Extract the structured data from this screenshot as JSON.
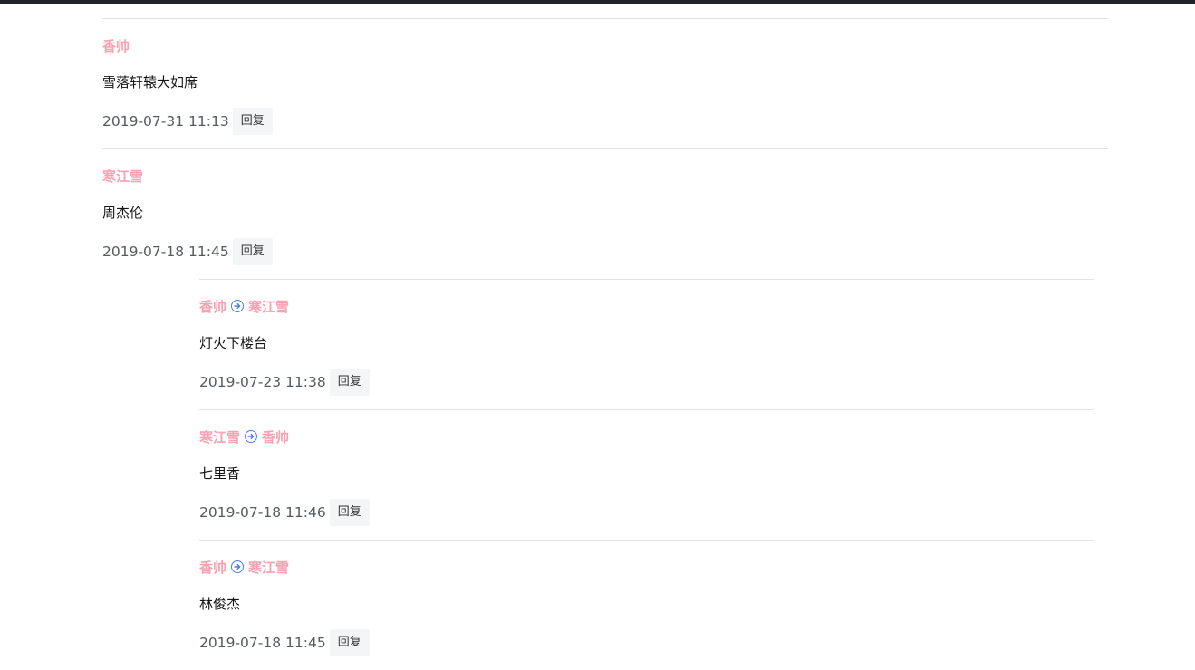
{
  "comments": [
    {
      "author": "香帅",
      "content": "雪落轩辕大如席",
      "time": "2019-07-31 11:13",
      "reply_label": "回复"
    },
    {
      "author": "寒江雪",
      "content": "周杰伦",
      "time": "2019-07-18 11:45",
      "reply_label": "回复",
      "replies": [
        {
          "from": "香帅",
          "to": "寒江雪",
          "content": "灯火下楼台",
          "time": "2019-07-23 11:38",
          "reply_label": "回复"
        },
        {
          "from": "寒江雪",
          "to": "香帅",
          "content": "七里香",
          "time": "2019-07-18 11:46",
          "reply_label": "回复"
        },
        {
          "from": "香帅",
          "to": "寒江雪",
          "content": "林俊杰",
          "time": "2019-07-18 11:45",
          "reply_label": "回复"
        }
      ]
    }
  ],
  "colors": {
    "author": "#f7a1b2",
    "arrow": "#4c7de6",
    "divider": "#e2e2e2",
    "time": "#555a60"
  },
  "icons": {
    "arrow": "arrow-right-circle-icon"
  }
}
